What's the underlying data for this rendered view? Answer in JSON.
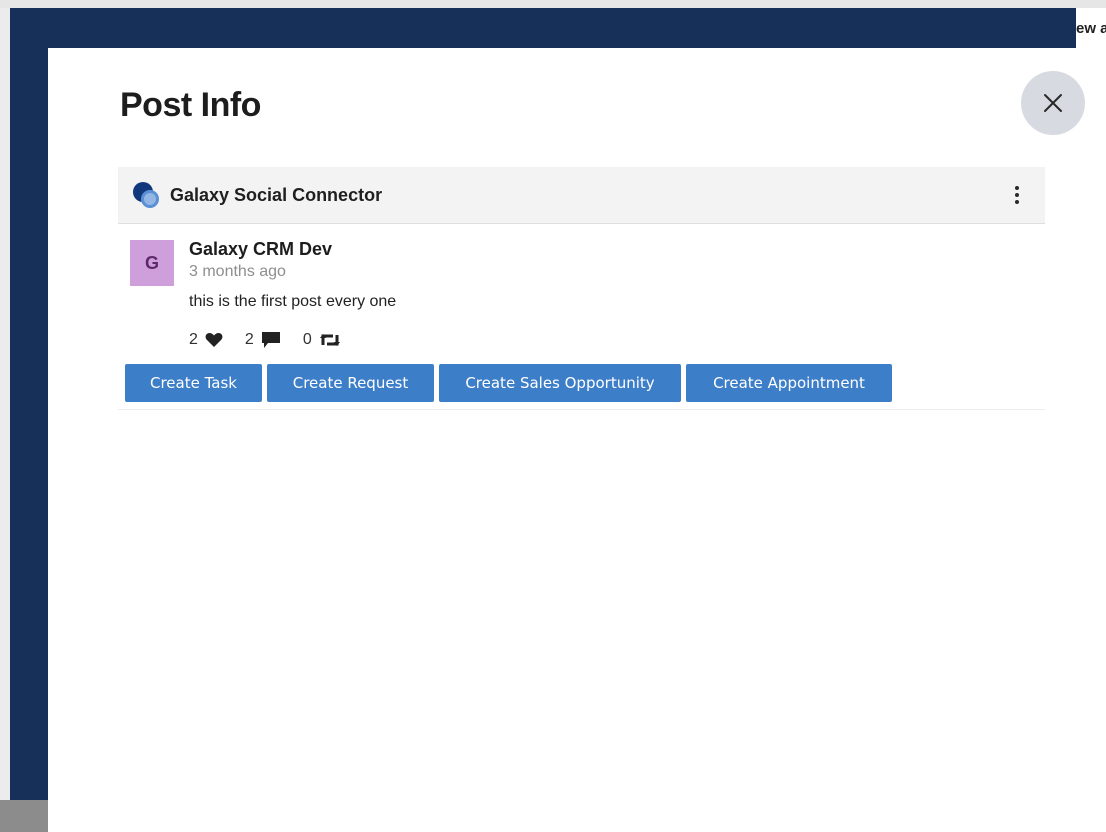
{
  "background": {
    "peek_text": "ew a"
  },
  "modal": {
    "title": "Post Info",
    "close_icon": "close-icon"
  },
  "card": {
    "header": {
      "logo_icon": "galaxy-logo-icon",
      "title": "Galaxy Social Connector",
      "menu_icon": "more-vertical-icon"
    },
    "post": {
      "avatar_letter": "G",
      "author": "Galaxy CRM Dev",
      "time": "3 months ago",
      "text": "this is the first post every one",
      "stats": {
        "likes": "2",
        "comments": "2",
        "shares": "0"
      }
    },
    "actions": [
      {
        "label": "Create Task"
      },
      {
        "label": "Create Request"
      },
      {
        "label": "Create Sales Opportunity"
      },
      {
        "label": "Create Appointment"
      }
    ]
  },
  "colors": {
    "navy_backdrop": "#16305a",
    "button_blue": "#3d7ec9",
    "avatar_purple": "#cf9fdc"
  }
}
